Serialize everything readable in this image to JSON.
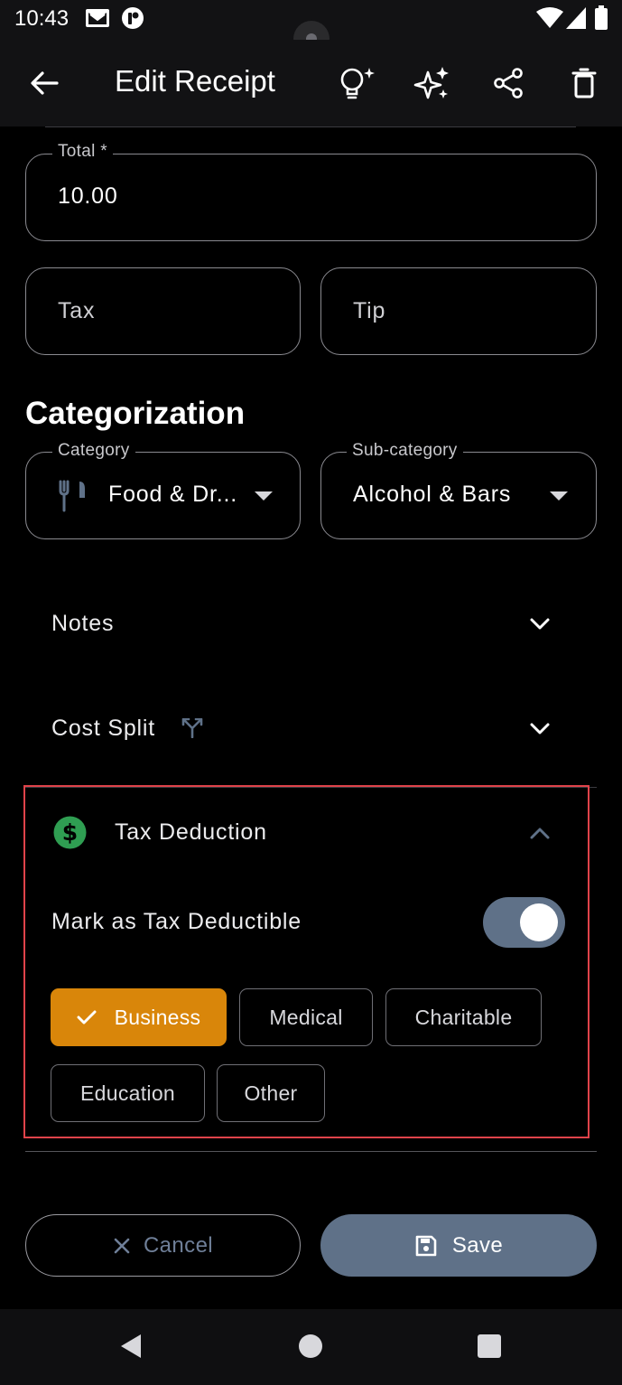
{
  "status_bar": {
    "time": "10:43",
    "icons": [
      "mail-icon",
      "app-badge-icon",
      "wifi-icon",
      "signal-icon",
      "battery-icon"
    ]
  },
  "app_bar": {
    "title": "Edit Receipt",
    "actions": [
      "back-arrow-icon",
      "lightbulb-sparkle-icon",
      "sparkles-icon",
      "share-icon",
      "trash-icon"
    ]
  },
  "fields": {
    "total_label": "Total *",
    "total_value": "10.00",
    "tax_placeholder": "Tax",
    "tip_placeholder": "Tip"
  },
  "categorization": {
    "title": "Categorization",
    "category_label": "Category",
    "category_value": "Food & Dr...",
    "category_icon": "fork-knife-icon",
    "subcategory_label": "Sub-category",
    "subcategory_value": "Alcohol & Bars"
  },
  "sections": {
    "notes": "Notes",
    "cost_split": "Cost Split",
    "tax_deduction": "Tax Deduction"
  },
  "tax_deduction": {
    "toggle_label": "Mark as Tax Deductible",
    "toggle_on": true,
    "chips": [
      {
        "label": "Business",
        "selected": true
      },
      {
        "label": "Medical",
        "selected": false
      },
      {
        "label": "Charitable",
        "selected": false
      },
      {
        "label": "Education",
        "selected": false
      },
      {
        "label": "Other",
        "selected": false
      }
    ]
  },
  "buttons": {
    "cancel": "Cancel",
    "save": "Save"
  },
  "colors": {
    "background": "#000000",
    "accent_orange": "#d9860a",
    "slate": "#5f7188",
    "dollar_green": "#2f9e52",
    "highlight_red": "#e0434a"
  }
}
